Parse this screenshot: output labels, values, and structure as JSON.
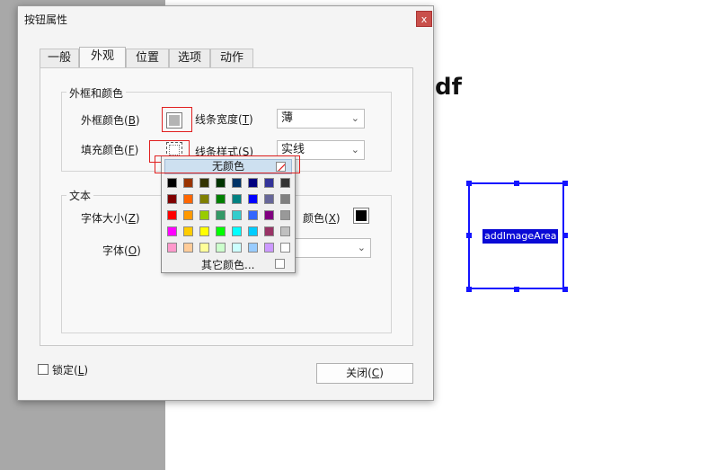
{
  "background": {
    "doc_heading": "df",
    "target_field_label": "addImageArea"
  },
  "dialog": {
    "title": "按钮属性",
    "close_glyph": "x",
    "tabs": [
      {
        "label": "一般"
      },
      {
        "label": "外观"
      },
      {
        "label": "位置"
      },
      {
        "label": "选项"
      },
      {
        "label": "动作"
      }
    ],
    "frame_group": {
      "title": "外框和颜色",
      "border_color_label": "外框颜色(",
      "border_color_key": "B",
      "fill_color_label": "填充颜色(",
      "fill_color_key": "F",
      "line_width_label": "线条宽度(",
      "line_width_key": "T",
      "line_width_value": "薄",
      "line_style_label": "线条样式(",
      "line_style_key": "S",
      "line_style_value": "实线",
      "border_color_hex": "#b4b4b4"
    },
    "text_group": {
      "title": "文本",
      "font_size_label": "字体大小(",
      "font_size_key": "Z",
      "text_color_label": "颜色(",
      "text_color_key": "X",
      "text_color_hex": "#000000",
      "font_label": "字体(",
      "font_key": "O"
    },
    "lock_label": "锁定(",
    "lock_key": "L",
    "close_button_label": "关闭(",
    "close_button_key": "C",
    "paren_close": ")"
  },
  "color_popup": {
    "no_color_label": "无颜色",
    "more_colors_label": "其它颜色...",
    "rows": [
      [
        "#000000",
        "#993300",
        "#333300",
        "#003300",
        "#003366",
        "#000080",
        "#333399",
        "#333333"
      ],
      [
        "#800000",
        "#ff6600",
        "#808000",
        "#008000",
        "#008080",
        "#0000ff",
        "#666699",
        "#808080"
      ],
      [
        "#ff0000",
        "#ff9900",
        "#99cc00",
        "#339966",
        "#33cccc",
        "#3366ff",
        "#800080",
        "#999999"
      ],
      [
        "#ff00ff",
        "#ffcc00",
        "#ffff00",
        "#00ff00",
        "#00ffff",
        "#00ccff",
        "#993366",
        "#c0c0c0"
      ],
      [
        "#ff99cc",
        "#ffcc99",
        "#ffff99",
        "#ccffcc",
        "#ccffff",
        "#99ccff",
        "#cc99ff",
        "#ffffff"
      ]
    ]
  }
}
